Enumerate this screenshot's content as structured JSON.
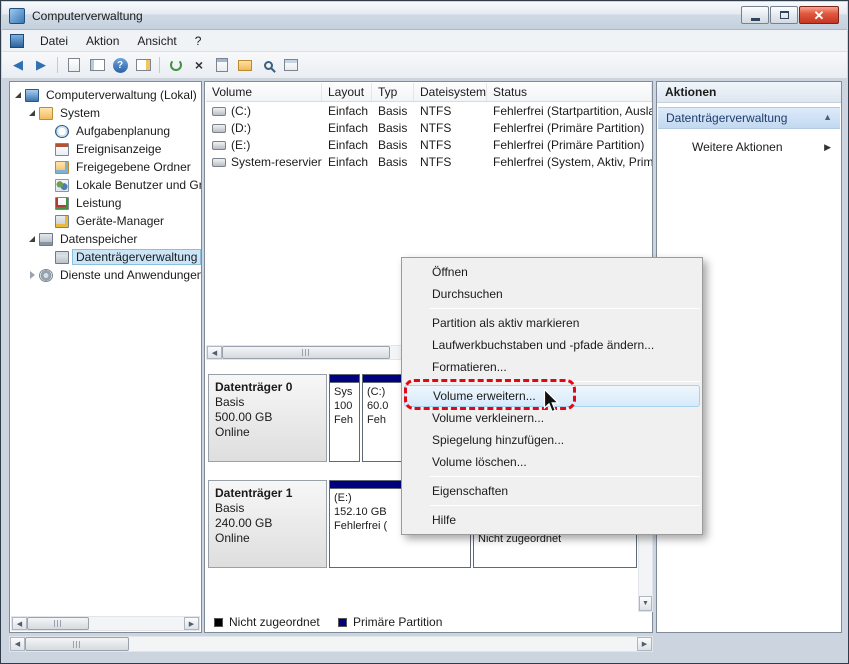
{
  "window": {
    "title": "Computerverwaltung",
    "controls": [
      "minimize-icon",
      "maximize-icon",
      "close-icon"
    ]
  },
  "menubar": {
    "items": [
      "Datei",
      "Aktion",
      "Ansicht",
      "?"
    ]
  },
  "toolbar": {
    "icons": [
      "back-icon",
      "forward-icon",
      "export-list-icon",
      "show-console-tree-icon",
      "help-icon",
      "show-action-pane-icon",
      "refresh-icon",
      "delete-icon",
      "properties-icon",
      "open-folder-icon",
      "find-icon",
      "settings-icon"
    ]
  },
  "tree": {
    "items": [
      {
        "label": "Computerverwaltung (Lokal)"
      },
      {
        "label": "System"
      },
      {
        "label": "Aufgabenplanung"
      },
      {
        "label": "Ereignisanzeige"
      },
      {
        "label": "Freigegebene Ordner"
      },
      {
        "label": "Lokale Benutzer und Gr"
      },
      {
        "label": "Leistung"
      },
      {
        "label": "Geräte-Manager"
      },
      {
        "label": "Datenspeicher"
      },
      {
        "label": "Datenträgerverwaltung"
      },
      {
        "label": "Dienste und Anwendungen"
      }
    ]
  },
  "volume_list": {
    "columns": [
      "Volume",
      "Layout",
      "Typ",
      "Dateisystem",
      "Status"
    ],
    "rows": [
      {
        "volume": "(C:)",
        "layout": "Einfach",
        "typ": "Basis",
        "dateisystem": "NTFS",
        "status": "Fehlerfrei (Startpartition, Ausla"
      },
      {
        "volume": "(D:)",
        "layout": "Einfach",
        "typ": "Basis",
        "dateisystem": "NTFS",
        "status": "Fehlerfrei (Primäre Partition)"
      },
      {
        "volume": "(E:)",
        "layout": "Einfach",
        "typ": "Basis",
        "dateisystem": "NTFS",
        "status": "Fehlerfrei (Primäre Partition)"
      },
      {
        "volume": "System-reserviert",
        "layout": "Einfach",
        "typ": "Basis",
        "dateisystem": "NTFS",
        "status": "Fehlerfrei (System, Aktiv, Prim"
      }
    ]
  },
  "disks": [
    {
      "name": "Datenträger 0",
      "type": "Basis",
      "size": "500.00 GB",
      "status": "Online",
      "partitions": [
        {
          "line1": "Sys",
          "line2": "100",
          "line3": "Feh"
        },
        {
          "line1": "(C:)",
          "line2": "60.0",
          "line3": "Feh"
        }
      ]
    },
    {
      "name": "Datenträger 1",
      "type": "Basis",
      "size": "240.00 GB",
      "status": "Online",
      "partitions": [
        {
          "line1": "(E:)",
          "line2": "152.10 GB",
          "line3": "Fehlerfrei ("
        }
      ],
      "unallocated_label": "Nicht zugeordnet"
    }
  ],
  "legend": {
    "unallocated": "Nicht zugeordnet",
    "primary": "Primäre Partition"
  },
  "actions_pane": {
    "title": "Aktionen",
    "section": "Datenträgerverwaltung",
    "more_actions": "Weitere Aktionen"
  },
  "context_menu": {
    "open": "Öffnen",
    "browse": "Durchsuchen",
    "mark_active": "Partition als aktiv markieren",
    "change_letter": "Laufwerkbuchstaben und -pfade ändern...",
    "format": "Formatieren...",
    "extend": "Volume erweitern...",
    "shrink": "Volume verkleinern...",
    "add_mirror": "Spiegelung hinzufügen...",
    "delete_volume": "Volume löschen...",
    "properties": "Eigenschaften",
    "help": "Hilfe"
  },
  "colors": {
    "primary_partition": "#000080",
    "unallocated": "#000000",
    "close_button": "#d64937",
    "annotation": "#e40613",
    "selection": "#cbe4f6"
  }
}
